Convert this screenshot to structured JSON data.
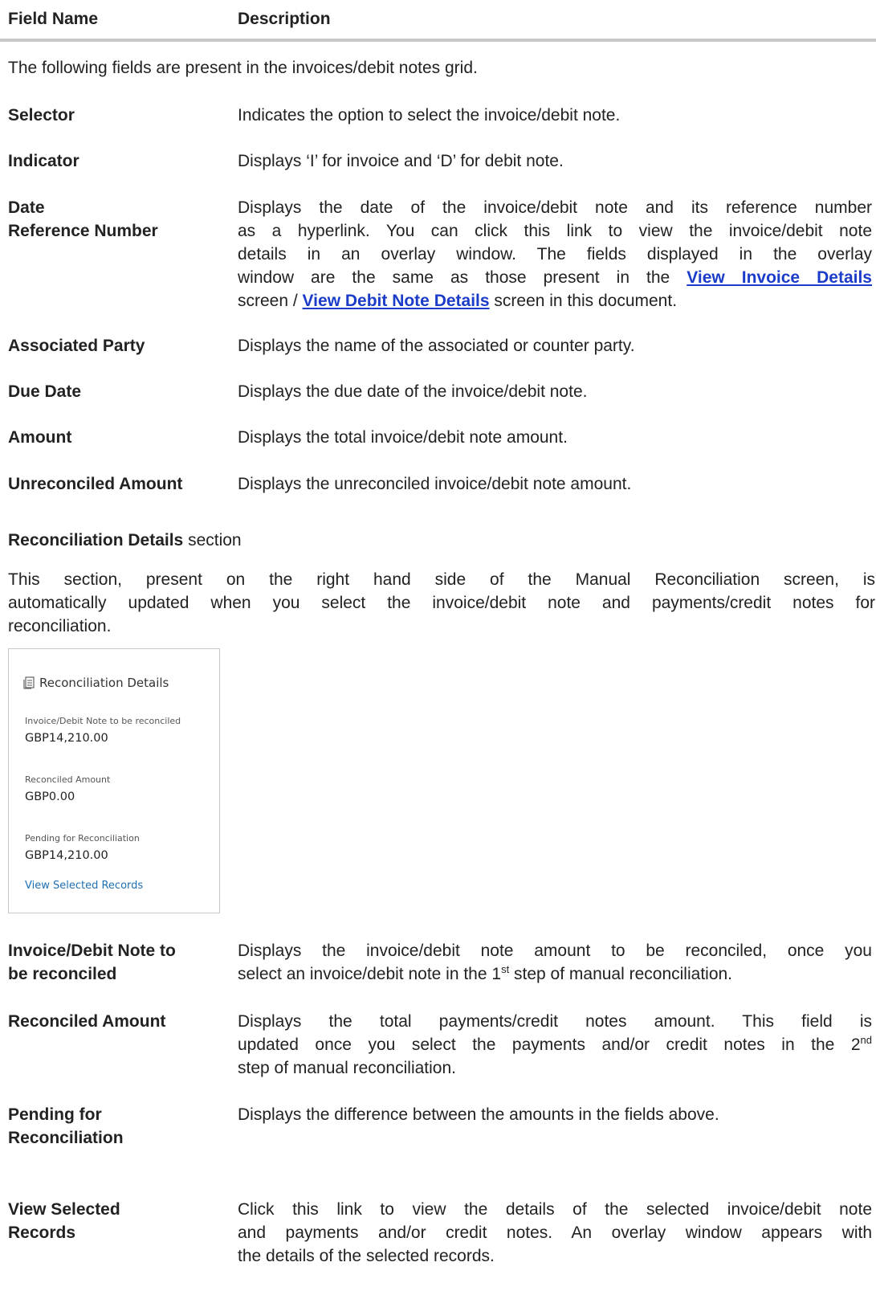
{
  "header": {
    "col1": "Field Name",
    "col2": "Description"
  },
  "intro": "The following fields are present in the invoices/debit notes grid.",
  "grid_fields": [
    {
      "label": "Selector",
      "desc": "Indicates the option to select the invoice/debit note."
    },
    {
      "label": "Indicator",
      "desc": "Displays ‘I’ for invoice and ‘D’ for debit note."
    },
    {
      "label_line1": "Date",
      "label_line2": "Reference Number",
      "desc_line1": "Displays the date of the invoice/debit note and its reference number",
      "desc_line2": "as a hyperlink. You can click this link to view the invoice/debit note",
      "desc_line3": "details in an overlay window. The fields displayed in the overlay",
      "desc_line4_pre": "window are the same as those present in the",
      "link1": "View Invoice Details",
      "desc_line5_pre": "screen /",
      "link2": "View Debit Note Details",
      "desc_line5_post": "screen in this document."
    },
    {
      "label": "Associated Party",
      "desc": "Displays the name of the associated or counter party."
    },
    {
      "label": "Due Date",
      "desc": "Displays the due date of the invoice/debit note."
    },
    {
      "label": "Amount",
      "desc": "Displays the total invoice/debit note amount."
    },
    {
      "label": "Unreconciled Amount",
      "desc": "Displays the unreconciled invoice/debit note amount."
    }
  ],
  "section": {
    "title_bold": "Reconciliation Details",
    "title_rest": "section"
  },
  "section_para": {
    "line1": "This section, present on the right hand side of the Manual Reconciliation screen, is",
    "line2": "automatically updated when you select the invoice/debit note and payments/credit notes for",
    "line3": "reconciliation."
  },
  "card": {
    "title": "Reconciliation Details",
    "icon": "document-list-icon",
    "invoice_label": "Invoice/Debit Note to be reconciled",
    "invoice_value": "GBP14,210.00",
    "reconciled_label": "Reconciled Amount",
    "reconciled_value": "GBP0.00",
    "pending_label": "Pending for Reconciliation",
    "pending_value": "GBP14,210.00",
    "link": "View Selected Records"
  },
  "recon_fields": {
    "invoice": {
      "label_line1": "Invoice/Debit Note to",
      "label_line2": "be reconciled",
      "desc_line1": "Displays the invoice/debit note amount to be reconciled, once you",
      "desc_line2_pre": "select an invoice/debit note in the 1",
      "desc_line2_sup": "st",
      "desc_line2_post": " step of manual reconciliation."
    },
    "reconciled": {
      "label": "Reconciled Amount",
      "desc_line1": "Displays the total payments/credit notes amount. This field is",
      "desc_line2_pre": "updated once you select the payments and/or credit notes in the 2",
      "desc_line2_sup": "nd",
      "desc_line3": "step of manual reconciliation."
    },
    "pending": {
      "label_line1": "Pending for",
      "label_line2": "Reconciliation",
      "desc": "Displays the difference between the amounts in the fields above."
    },
    "view": {
      "label_line1": "View Selected",
      "label_line2": "Records",
      "desc_line1": "Click this link to view the details of the selected invoice/debit note",
      "desc_line2": "and payments and/or credit notes. An overlay window appears with",
      "desc_line3": "the details of the selected records."
    }
  }
}
